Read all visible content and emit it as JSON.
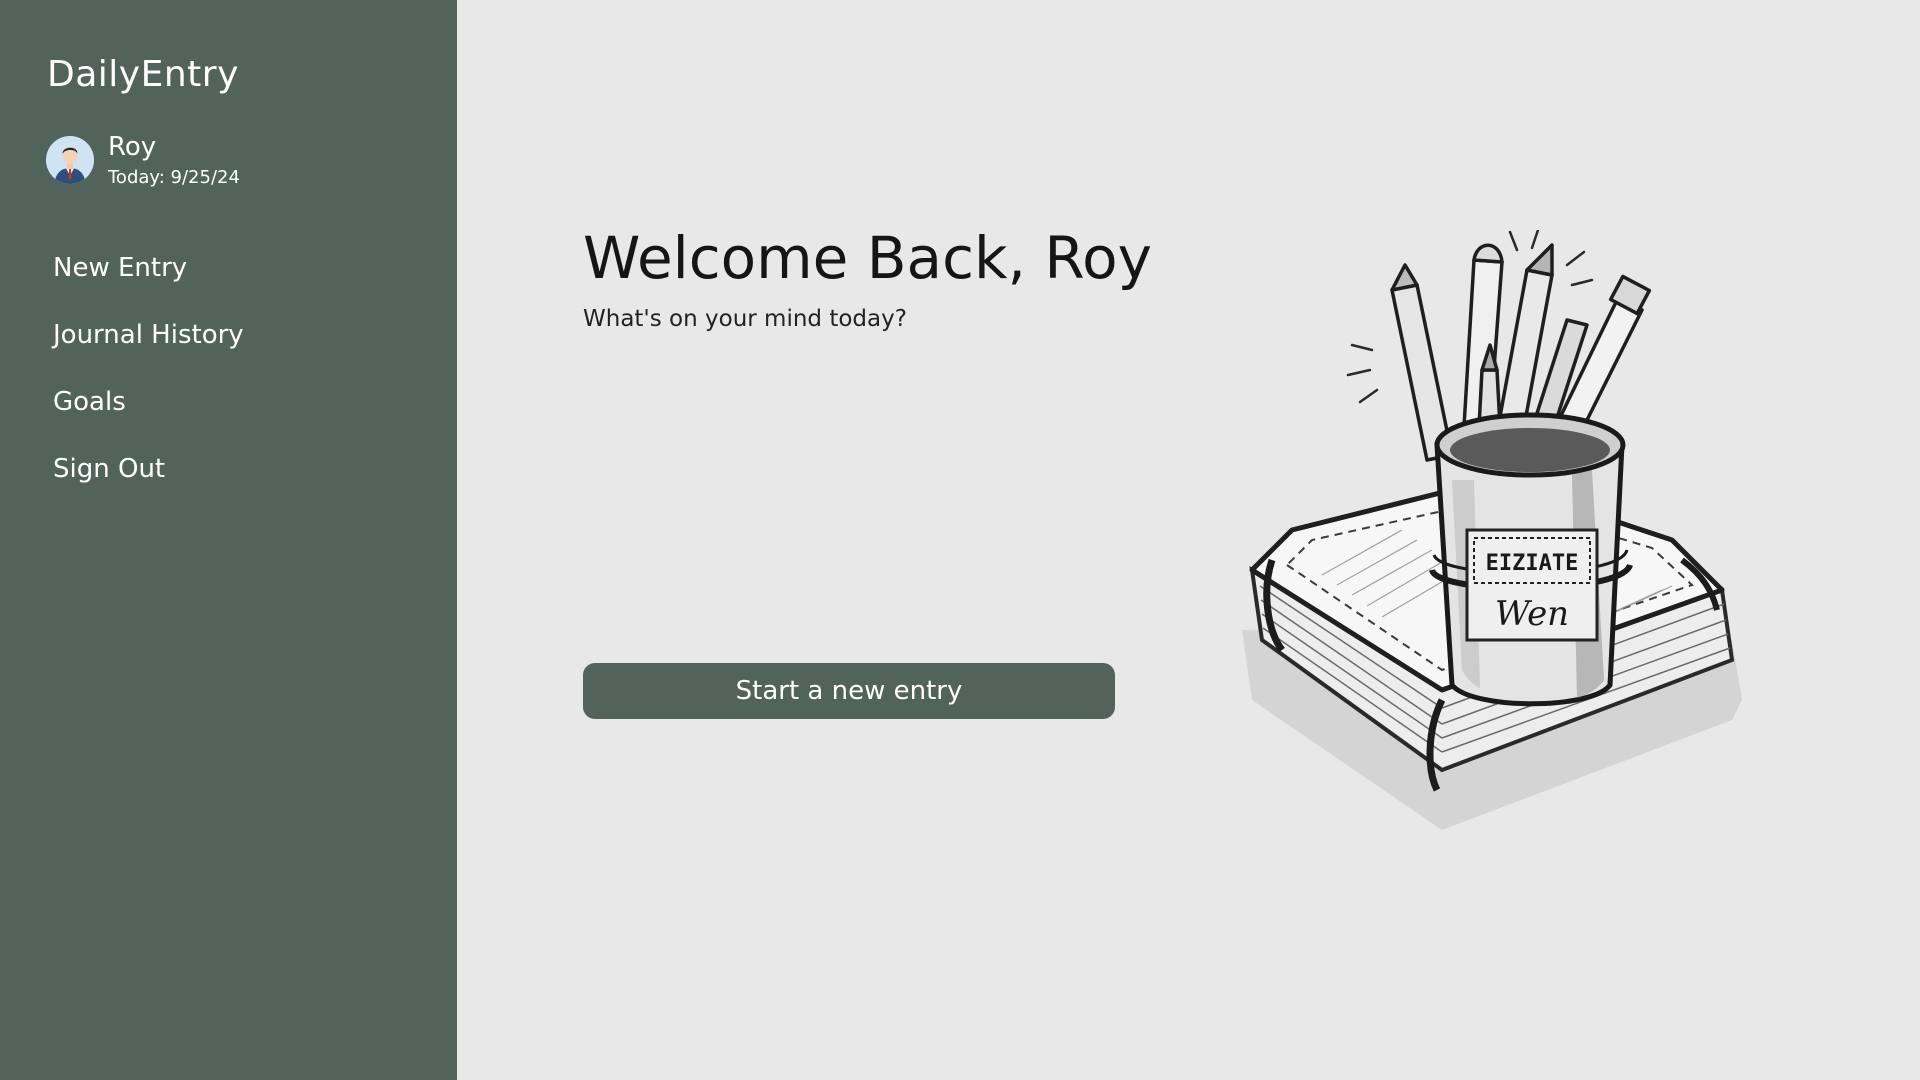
{
  "app": {
    "title": "DailyEntry"
  },
  "user": {
    "name": "Roy",
    "date": "Today: 9/25/24",
    "avatar_icon": "user-avatar-icon"
  },
  "sidebar": {
    "items": [
      {
        "label": "New Entry"
      },
      {
        "label": "Journal History"
      },
      {
        "label": "Goals"
      },
      {
        "label": "Sign Out"
      }
    ]
  },
  "main": {
    "welcome": "Welcome Back, Roy",
    "subtitle": "What's on your mind today?",
    "start_button": "Start a new entry",
    "illustration": {
      "icon": "notebook-pencil-cup-sketch",
      "label_text_1": "EIZIATE",
      "label_text_2": "Wen"
    }
  },
  "colors": {
    "sidebar_bg": "#52635b",
    "main_bg": "#e8e8e8",
    "button_bg": "#52635b",
    "text_light": "#ffffff",
    "text_dark": "#151515"
  }
}
